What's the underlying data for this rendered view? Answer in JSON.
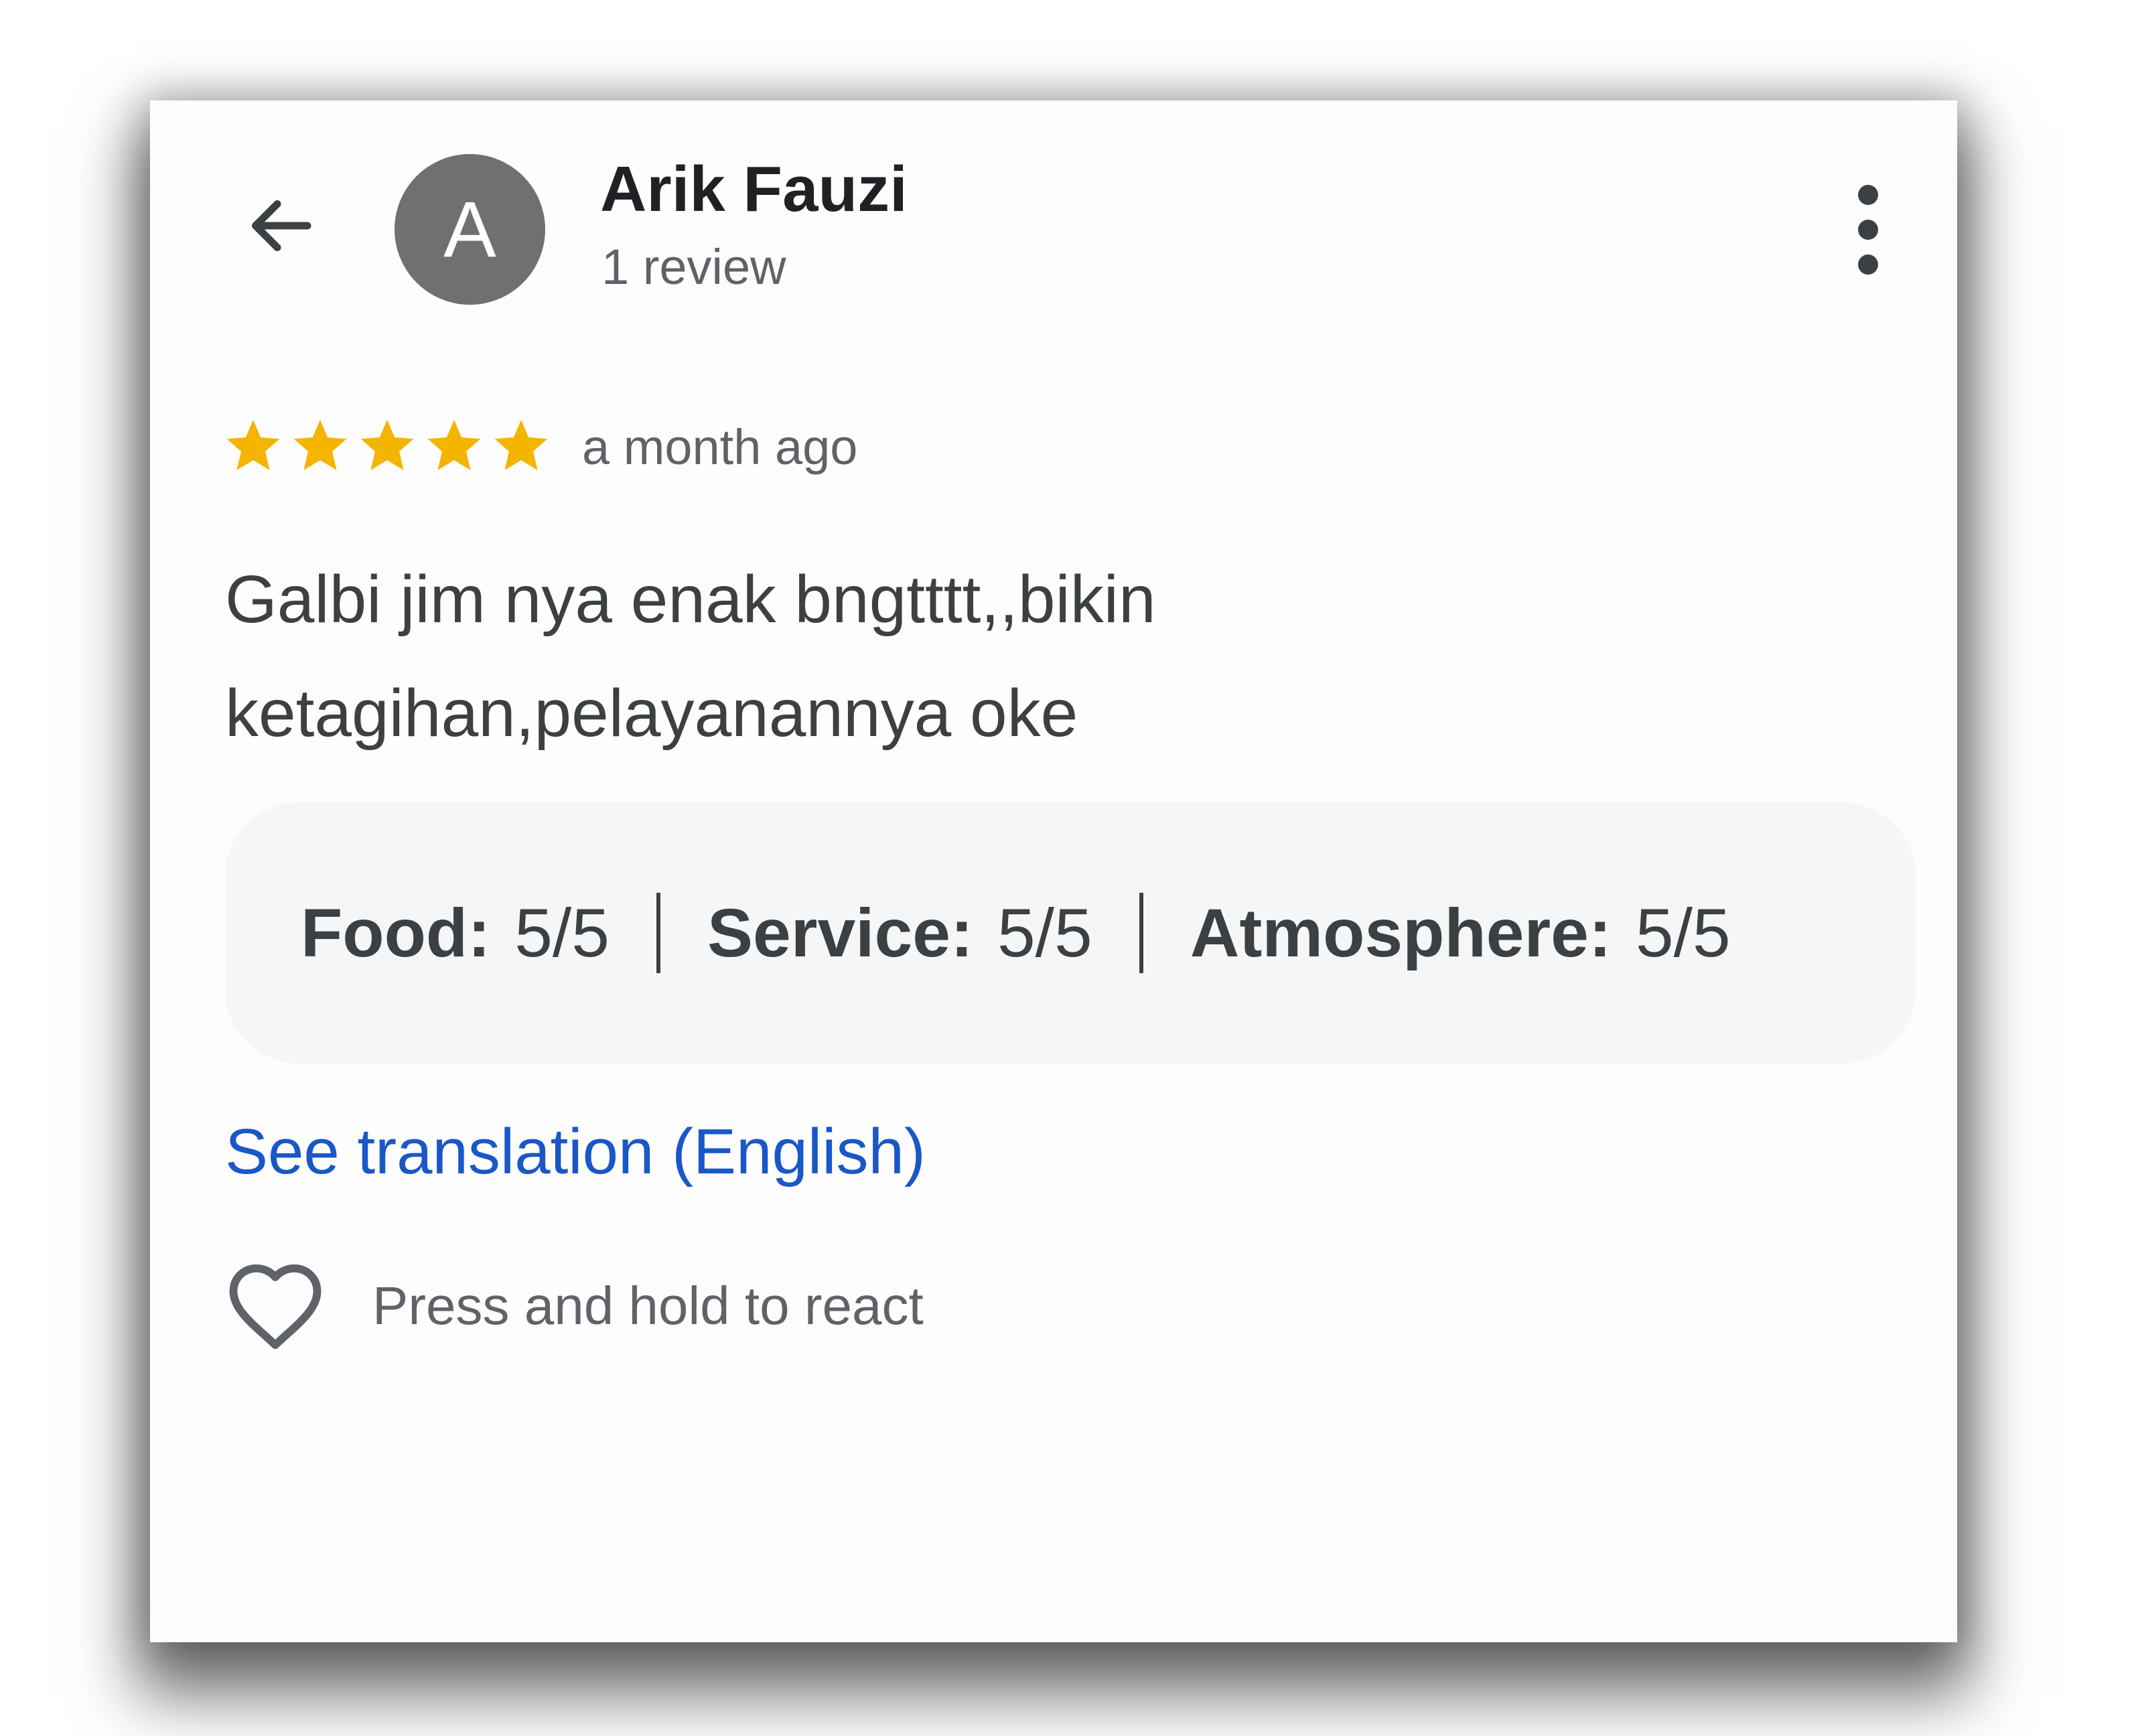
{
  "header": {
    "back_icon": "arrow-left-icon",
    "avatar_letter": "A",
    "user_name": "Arik Fauzi",
    "review_count": "1 review",
    "more_icon": "more-vert-icon"
  },
  "review": {
    "rating": 5,
    "max_rating": 5,
    "star_color": "#f4b400",
    "time": "a month ago",
    "text_lines": [
      "Galbi jim nya enak bngtttt,,bikin",
      "ketagihan,pelayanannya oke"
    ],
    "sub_ratings": [
      {
        "label": "Food:",
        "value": "5/5"
      },
      {
        "label": "Service:",
        "value": "5/5"
      },
      {
        "label": "Atmosphere:",
        "value": "5/5"
      }
    ]
  },
  "translate_link": "See translation (English)",
  "react": {
    "icon": "heart-icon",
    "label": "Press and hold to react"
  },
  "colors": {
    "link": "#1a57c7",
    "avatar_bg": "#707070",
    "ratings_bg": "#f5f6f7"
  }
}
